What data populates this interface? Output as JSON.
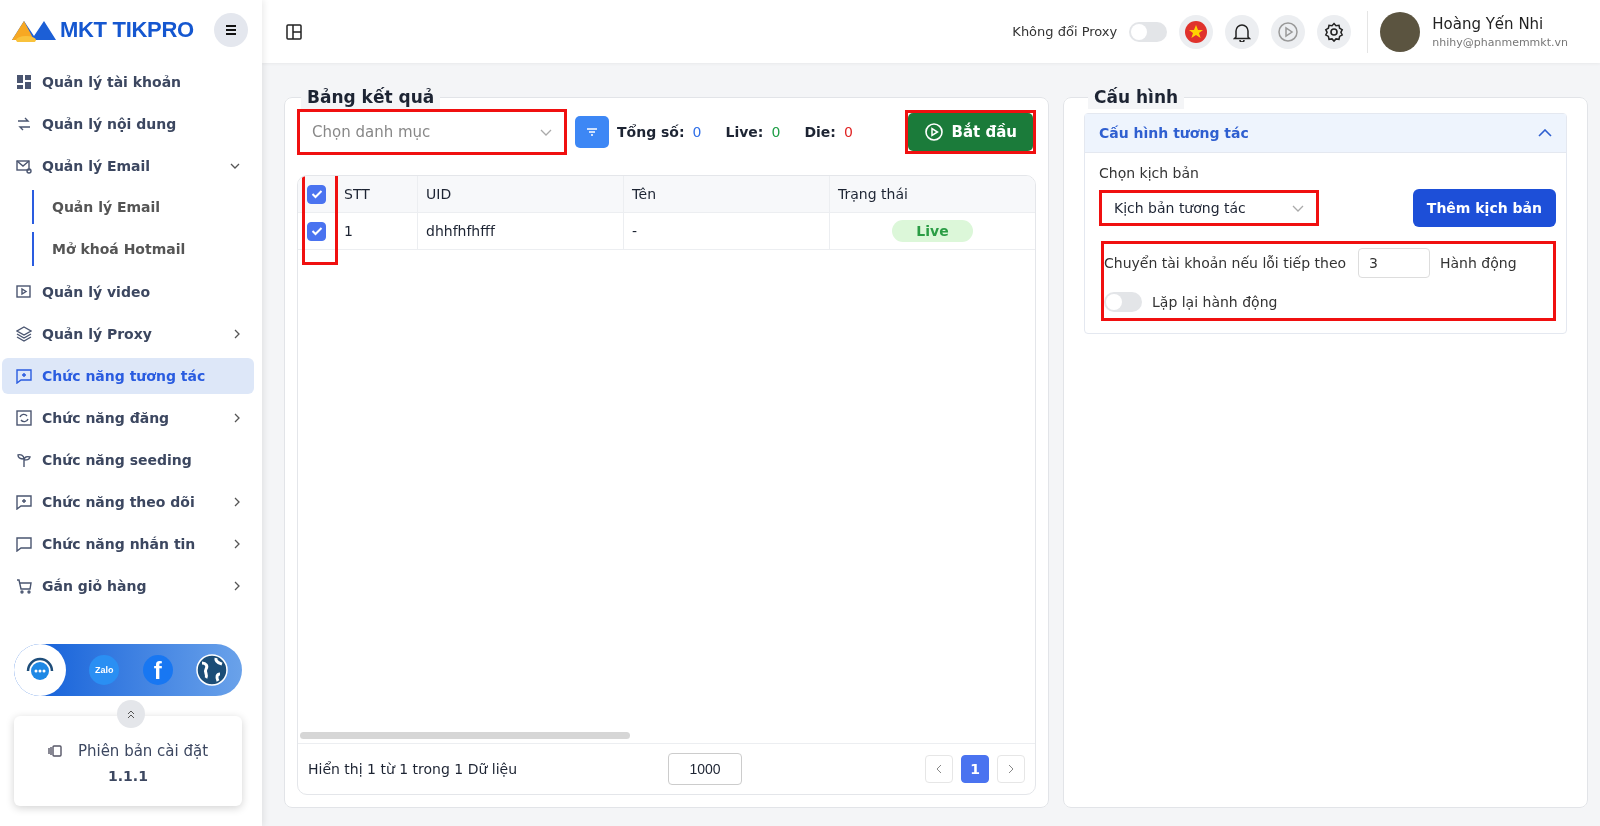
{
  "sidebar": {
    "logo": "MKT TIKPRO",
    "items": [
      {
        "label": "Quản lý tài khoản",
        "kind": "link",
        "selected": false
      },
      {
        "label": "Quản lý nội dung",
        "kind": "link",
        "selected": false
      },
      {
        "label": "Quản lý Email",
        "kind": "group",
        "expanded": true,
        "selected": false,
        "children": [
          {
            "label": "Quản lý Email"
          },
          {
            "label": "Mở khoá Hotmail"
          }
        ]
      },
      {
        "label": "Quản lý video",
        "kind": "link",
        "selected": false
      },
      {
        "label": "Quản lý Proxy",
        "kind": "group",
        "expanded": false,
        "selected": false
      },
      {
        "label": "Chức năng tương tác",
        "kind": "link",
        "selected": true
      },
      {
        "label": "Chức năng đăng",
        "kind": "group",
        "expanded": false,
        "selected": false
      },
      {
        "label": "Chức năng seeding",
        "kind": "link",
        "selected": false
      },
      {
        "label": "Chức năng theo dõi",
        "kind": "group",
        "expanded": false,
        "selected": false
      },
      {
        "label": "Chức năng nhắn tin",
        "kind": "group",
        "expanded": false,
        "selected": false
      },
      {
        "label": "Gắn giỏ hàng",
        "kind": "group",
        "expanded": false,
        "selected": false
      }
    ],
    "socials": [
      {
        "kind": "support"
      },
      {
        "kind": "zalo",
        "label": "Zalo"
      },
      {
        "kind": "facebook",
        "label": "f"
      },
      {
        "kind": "globe"
      }
    ],
    "version": {
      "label": "Phiên bản cài đặt",
      "value": "1.1.1"
    }
  },
  "header": {
    "proxy_label": "Không đổi Proxy",
    "proxy_on": false,
    "user_name": "Hoàng Yến Nhi",
    "user_email": "nhihy@phanmemmkt.vn"
  },
  "results": {
    "title": "Bảng kết quả",
    "category_placeholder": "Chọn danh mục",
    "category_highlighted": true,
    "stats": [
      {
        "label": "Tổng số:",
        "value": "0",
        "color": "#2f6fe8"
      },
      {
        "label": "Live:",
        "value": "0",
        "color": "#1e9e46"
      },
      {
        "label": "Die:",
        "value": "0",
        "color": "#e02424"
      }
    ],
    "start_button": "Bắt đầu",
    "start_highlighted": true,
    "table": {
      "columns": [
        "STT",
        "UID",
        "Tên",
        "Trạng thái"
      ],
      "all_checked": true,
      "checkbox_column_highlighted": true,
      "rows": [
        {
          "checked": true,
          "cells": [
            "1",
            "dhhfhfhfff",
            "-"
          ],
          "status": "Live"
        }
      ]
    },
    "footer": {
      "summary": "Hiển thị 1 từ 1 trong 1 Dữ liệu",
      "page_size": "1000",
      "pages": [
        {
          "label": "1",
          "selected": true
        }
      ]
    }
  },
  "config": {
    "title": "Cấu hình",
    "section": "Cấu hình tương tác",
    "expanded": true,
    "script_label": "Chọn kịch bản",
    "script_value": "Kịch bản tương tác",
    "script_highlighted": true,
    "add_button": "Thêm kịch bản",
    "options_highlighted": true,
    "switch_label": "Chuyển tài khoản nếu lỗi tiếp theo",
    "switch_value": "3",
    "switch_unit": "Hành động",
    "repeat_label": "Lặp lại hành động",
    "repeat_on": false
  }
}
